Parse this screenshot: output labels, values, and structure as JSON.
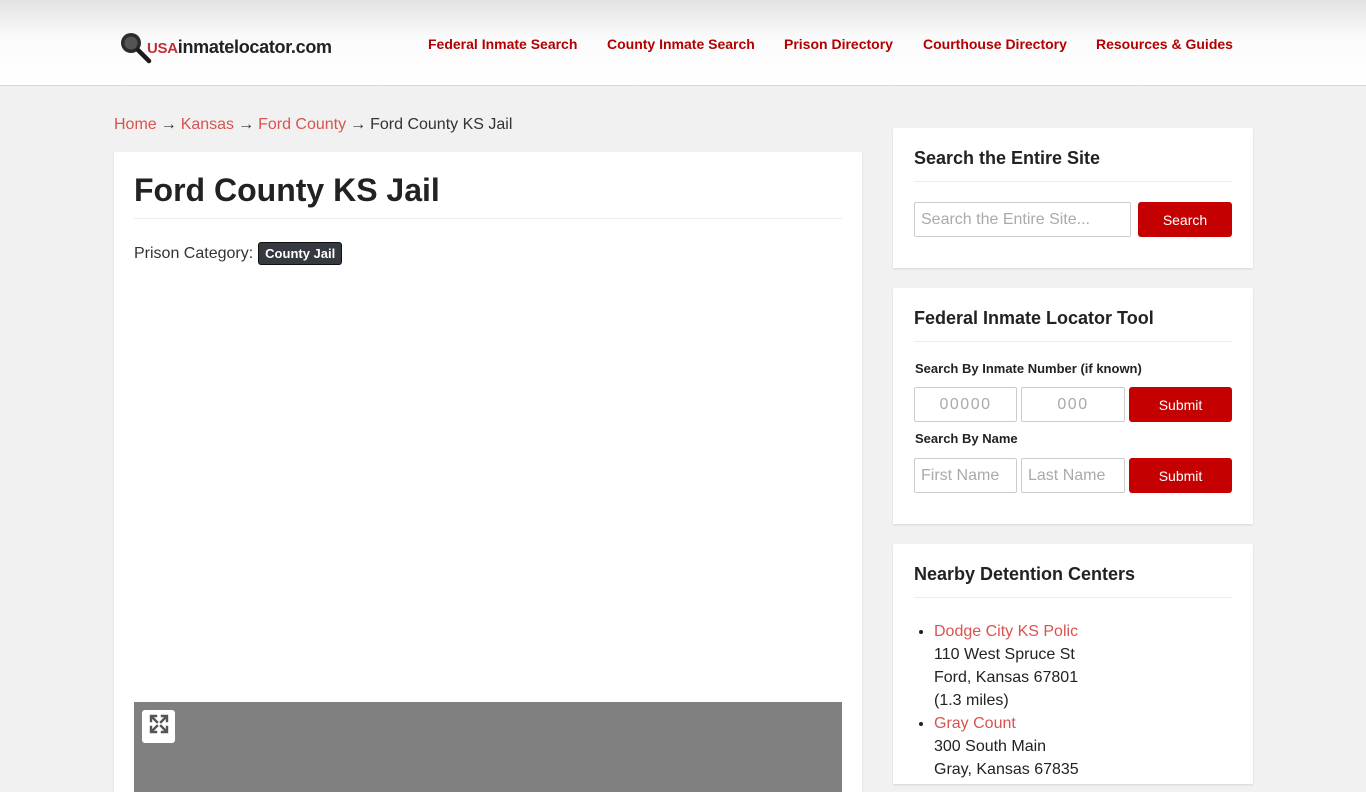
{
  "header": {
    "logo_prefix": "USA",
    "logo_rest": "inmatelocator.com",
    "nav": [
      {
        "label": "Federal Inmate Search"
      },
      {
        "label": "County Inmate Search"
      },
      {
        "label": "Prison Directory"
      },
      {
        "label": "Courthouse Directory"
      },
      {
        "label": "Resources & Guides"
      }
    ]
  },
  "breadcrumb": {
    "items": [
      "Home",
      "Kansas",
      "Ford County"
    ],
    "current": "Ford County KS Jail",
    "separator": "→"
  },
  "main": {
    "title": "Ford County KS Jail",
    "category_label": "Prison Category:",
    "category_badge": "County Jail"
  },
  "sidebar": {
    "search": {
      "title": "Search the Entire Site",
      "placeholder": "Search the Entire Site...",
      "button": "Search"
    },
    "federal": {
      "title": "Federal Inmate Locator Tool",
      "number_label": "Search By Inmate Number (if known)",
      "number_placeholder_1": "00000",
      "number_placeholder_2": "000",
      "submit_1": "Submit",
      "name_label": "Search By Name",
      "first_placeholder": "First Name",
      "last_placeholder": "Last Name",
      "submit_2": "Submit"
    },
    "nearby": {
      "title": "Nearby Detention Centers",
      "items": [
        {
          "name": "Dodge City KS Polic",
          "address": "110 West Spruce St",
          "city": "Ford, Kansas 67801",
          "distance": "(1.3 miles)"
        },
        {
          "name": "Gray Count",
          "address": "300 South Main",
          "city": "Gray, Kansas 67835"
        }
      ]
    }
  },
  "colors": {
    "brand_red": "#c40000",
    "link_red": "#d9534f",
    "badge_dark": "#343a40"
  }
}
